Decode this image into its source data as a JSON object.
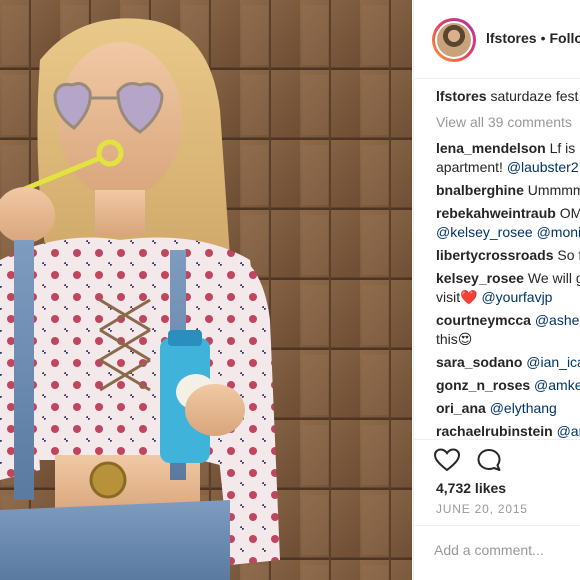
{
  "post": {
    "username": "lfstores",
    "separator": "•",
    "follow_label": "Follo",
    "caption_user": "lfstores",
    "caption_text": " saturdaze fest",
    "view_all": "View all 39 comments",
    "likes": "4,732 likes",
    "date": "JUNE 20, 2015",
    "add_comment_placeholder": "Add a comment..."
  },
  "comments": [
    {
      "user": "lena_mendelson",
      "text": " Lf is r",
      "line2": "apartment! ",
      "line2_mention": "@laubster2"
    },
    {
      "user": "bnalberghine",
      "text": " Ummmm"
    },
    {
      "user": "rebekahweintraub",
      "text": " OM",
      "line2_mention": "@kelsey_rosee",
      "line2_text": " ",
      "line2_mention2": "@monic"
    },
    {
      "user": "libertycrossroads",
      "text": " So f"
    },
    {
      "user": "kelsey_rosee",
      "text": " We will g",
      "line2": "visit",
      "line2_emoji": "❤️",
      "line2_text": " ",
      "line2_mention": "@yourfavjp"
    },
    {
      "user": "courtneymcca",
      "text": " ",
      "mention": "@ashel",
      "line2": "this",
      "line2_emoji": "😍"
    },
    {
      "user": "sara_sodano",
      "text": " ",
      "mention": "@ian_icar"
    },
    {
      "user": "gonz_n_roses",
      "text": " ",
      "mention": "@amkell"
    },
    {
      "user": "ori_ana",
      "text": " ",
      "mention": "@elythang"
    },
    {
      "user": "rachaelrubinstein",
      "text": " ",
      "mention": "@am"
    }
  ],
  "icons": {
    "like": "heart-icon",
    "comment": "comment-bubble-icon"
  },
  "colors": {
    "text": "#262626",
    "muted": "#999999",
    "mention": "#003569",
    "border": "#efefef"
  }
}
